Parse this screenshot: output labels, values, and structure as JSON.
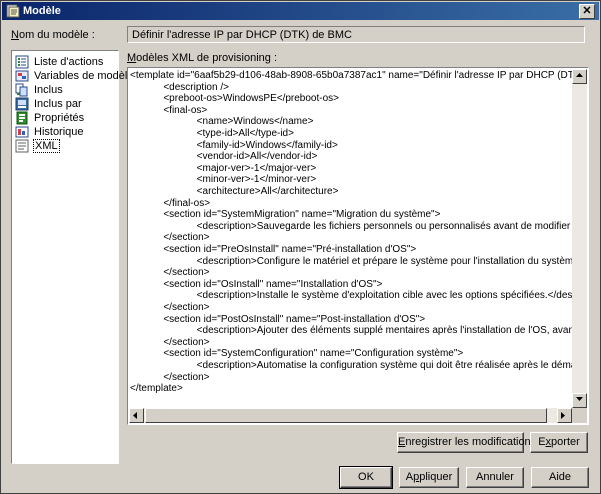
{
  "window": {
    "title": "Modèle"
  },
  "form": {
    "name_label_mnemonic": "N",
    "name_label_rest": "om du modèle :",
    "name_value": "Définir l'adresse IP par DHCP (DTK) de BMC",
    "xml_label_mnemonic": "M",
    "xml_label_rest": "odèles XML de provisioning :"
  },
  "nav": {
    "items": [
      {
        "label": "Liste d'actions",
        "icon": "action-list-icon"
      },
      {
        "label": "Variables de modèle",
        "icon": "variables-icon"
      },
      {
        "label": "Inclus",
        "icon": "included-icon"
      },
      {
        "label": "Inclus par",
        "icon": "included-by-icon"
      },
      {
        "label": "Propriétés",
        "icon": "properties-icon"
      },
      {
        "label": "Historique",
        "icon": "history-icon"
      },
      {
        "label": "XML",
        "icon": "xml-icon",
        "selected": true
      }
    ]
  },
  "xml_lines": [
    "<template id=\"6aaf5b29-d106-48ab-8908-65b0a7387ac1\" name=\"Définir l'adresse IP par DHCP (DTK) de BMC\" versio",
    "            <description />",
    "            <preboot-os>WindowsPE</preboot-os>",
    "            <final-os>",
    "                        <name>Windows</name>",
    "                        <type-id>All</type-id>",
    "                        <family-id>Windows</family-id>",
    "                        <vendor-id>All</vendor-id>",
    "                        <major-ver>-1</major-ver>",
    "                        <minor-ver>-1</minor-ver>",
    "                        <architecture>All</architecture>",
    "            </final-os>",
    "            <section id=\"SystemMigration\" name=\"Migration du système\">",
    "                        <description>Sauvegarde les fichiers personnels ou personnalisés avant de modifier le système.</d",
    "            </section>",
    "            <section id=\"PreOsInstall\" name=\"Pré-installation d'OS\">",
    "                        <description>Configure le matériel et prépare le système pour l'installation du système d'exploitation",
    "            </section>",
    "            <section id=\"OsInstall\" name=\"Installation d'OS\">",
    "                        <description>Installe le système d'exploitation cible avec les options spécifiées.</description>",
    "            </section>",
    "            <section id=\"PostOsInstall\" name=\"Post-installation d'OS\">",
    "                        <description>Ajouter des éléments supplé mentaires après l'installation de l'OS, avant redémarrage s",
    "            </section>",
    "            <section id=\"SystemConfiguration\" name=\"Configuration système\">",
    "                        <description>Automatise la configuration système qui doit être réalisée après le démarrage dans l'OS",
    "            </section>",
    "</template>"
  ],
  "buttons": {
    "save_mnemonic": "E",
    "save_rest": "nregistrer les modifications",
    "export_mnemonic": "x",
    "export_pre": "E",
    "export_rest": "porter",
    "ok": "OK",
    "apply_mnemonic": "p",
    "apply_pre": "A",
    "apply_rest": "pliquer",
    "cancel": "Annuler",
    "help": "Aide"
  }
}
